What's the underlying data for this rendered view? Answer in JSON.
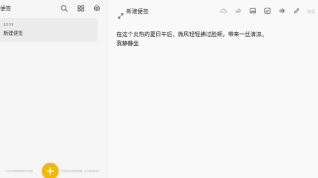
{
  "sidebar": {
    "title": "便签",
    "note": {
      "time": "18:59",
      "title": "新建便签"
    },
    "footer_left": "可在手机端和网页端同步查看",
    "footer_right": "登录后可在电脑端查看，可以跨设备同步"
  },
  "editor": {
    "title": "新建便签",
    "done_label": "完成",
    "lines": [
      "在这个炎热的夏日午后，微风轻轻拂过脸颊，带来一丝清凉。",
      "我静静坐"
    ]
  },
  "colors": {
    "fab": "#f5b800",
    "accent_text": "#1a1a1a"
  },
  "icons": {
    "header": [
      "search-icon",
      "grid-icon",
      "settings-icon"
    ],
    "toolbar": [
      "cloud-icon",
      "share-icon",
      "image-icon",
      "checkbox-icon",
      "voice-icon",
      "pen-icon"
    ]
  }
}
